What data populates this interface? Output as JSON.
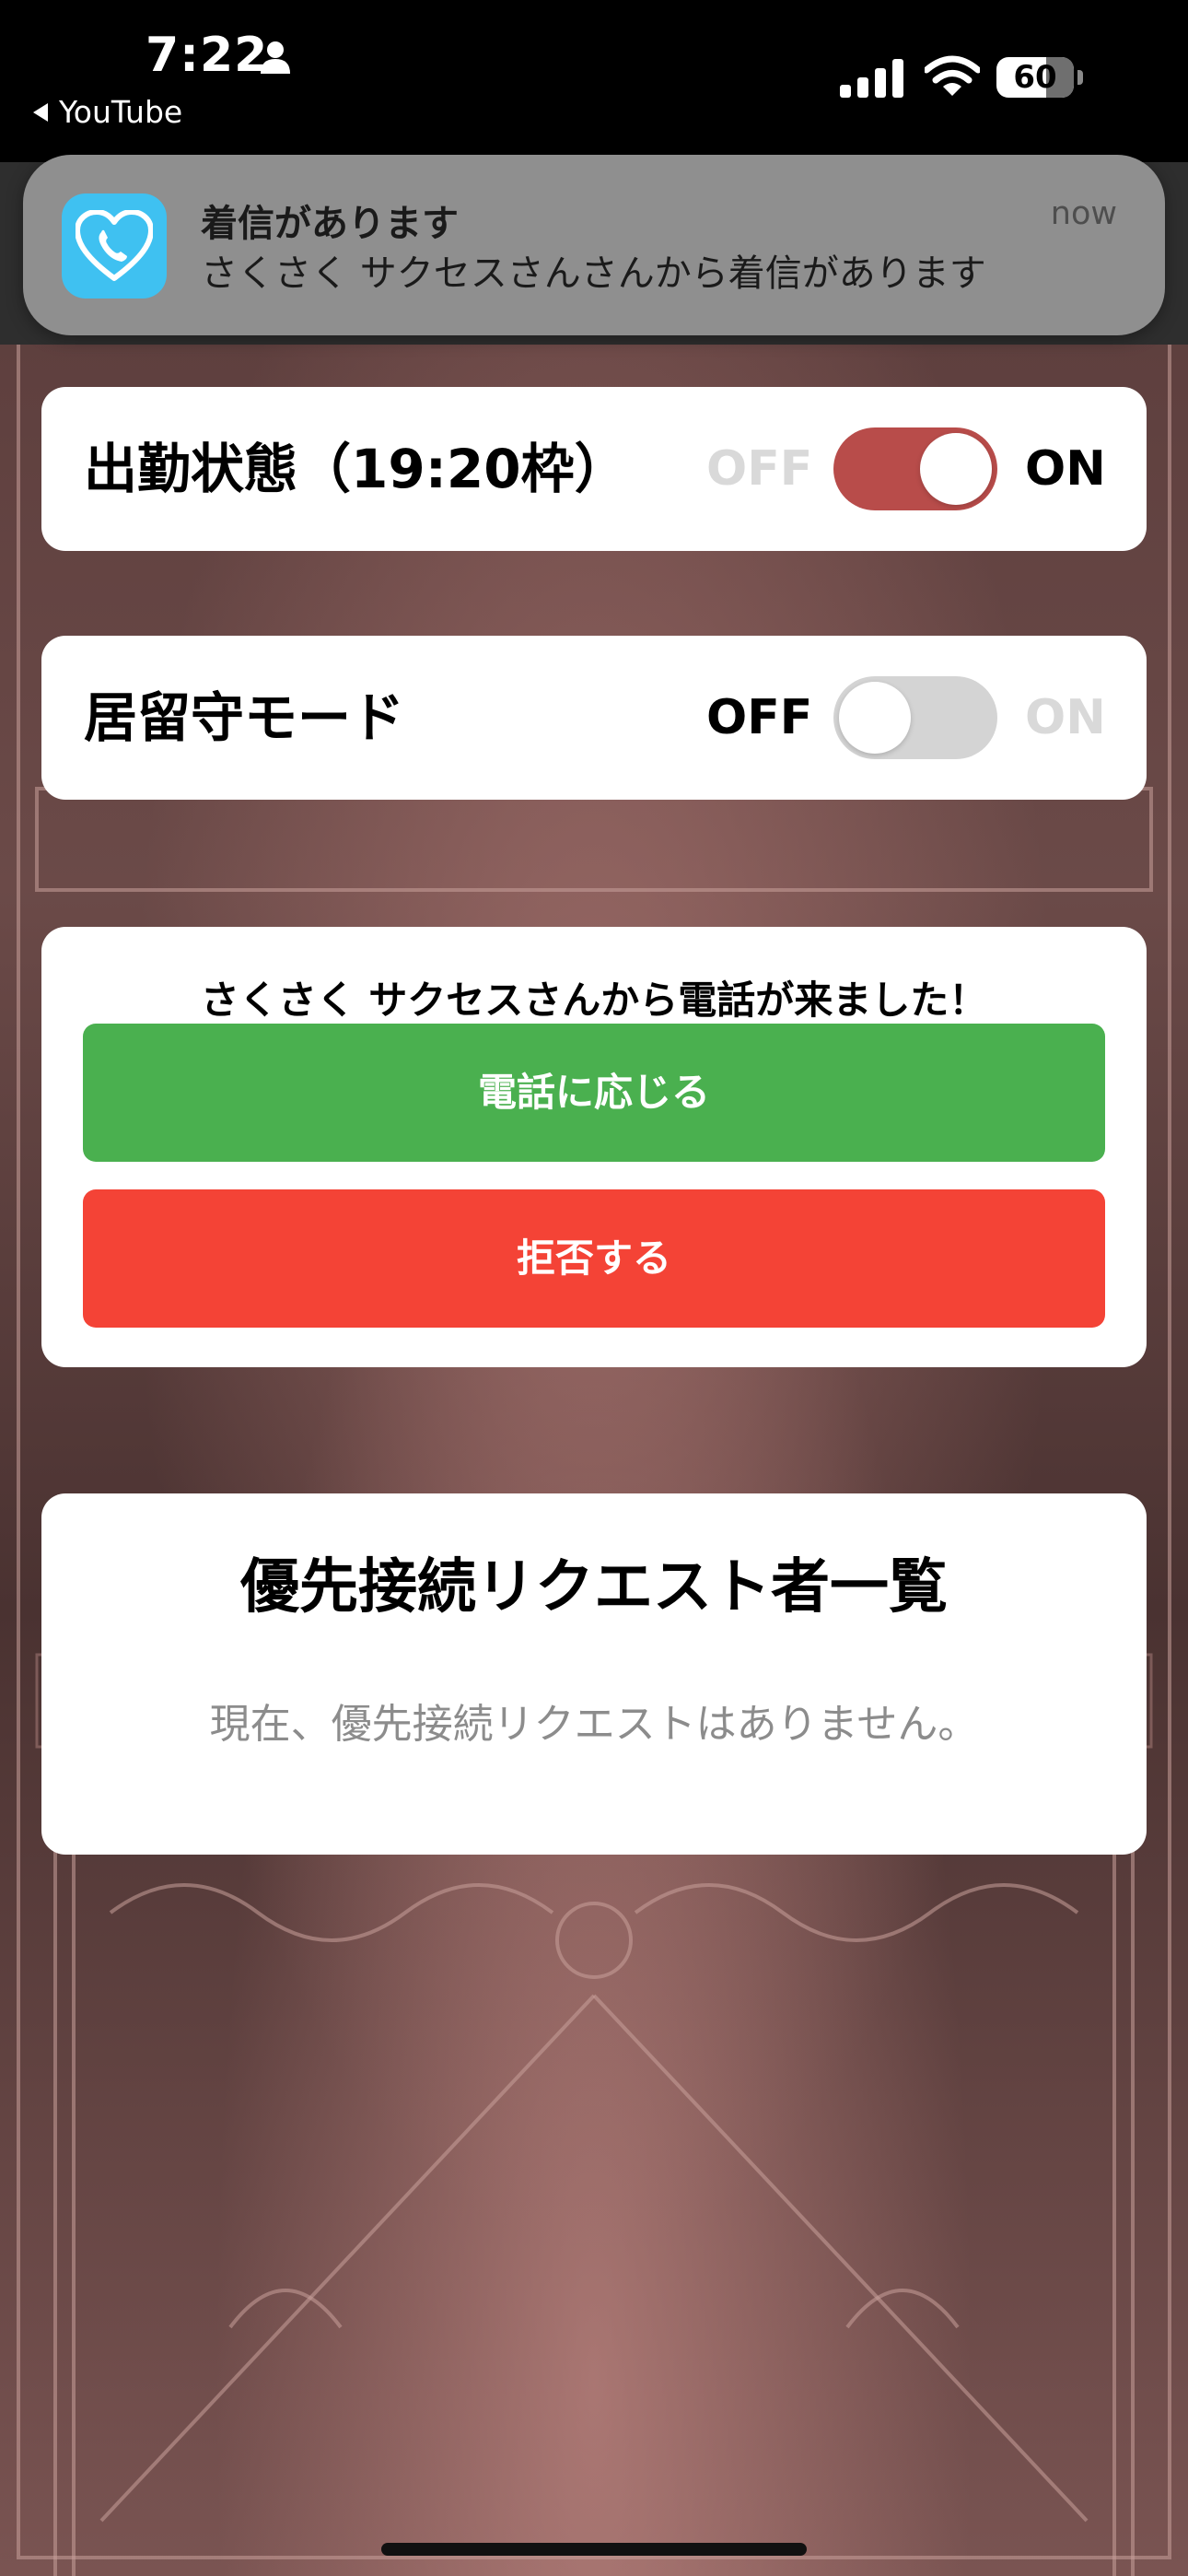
{
  "status_bar": {
    "time": "7:22",
    "back_app": "YouTube",
    "battery": "60"
  },
  "notification": {
    "title": "着信があります",
    "body": "さくさく サクセスさんさんから着信があります",
    "time": "now",
    "app_icon": "heart-phone-icon",
    "icon_color": "#3fc1f1"
  },
  "attendance": {
    "label": "出勤状態（19:20枠）",
    "off_label": "OFF",
    "on_label": "ON",
    "state": "on",
    "accent": "#b84c4a"
  },
  "answering_machine": {
    "label": "居留守モード",
    "off_label": "OFF",
    "on_label": "ON",
    "state": "off"
  },
  "incoming_call": {
    "message": "さくさく サクセスさんから電話が来ました！",
    "answer_label": "電話に応じる",
    "answer_color": "#4ab04f",
    "decline_label": "拒否する",
    "decline_color": "#f44336"
  },
  "priority_list": {
    "title": "優先接続リクエスト者一覧",
    "empty_message": "現在、優先接続リクエストはありません。"
  }
}
